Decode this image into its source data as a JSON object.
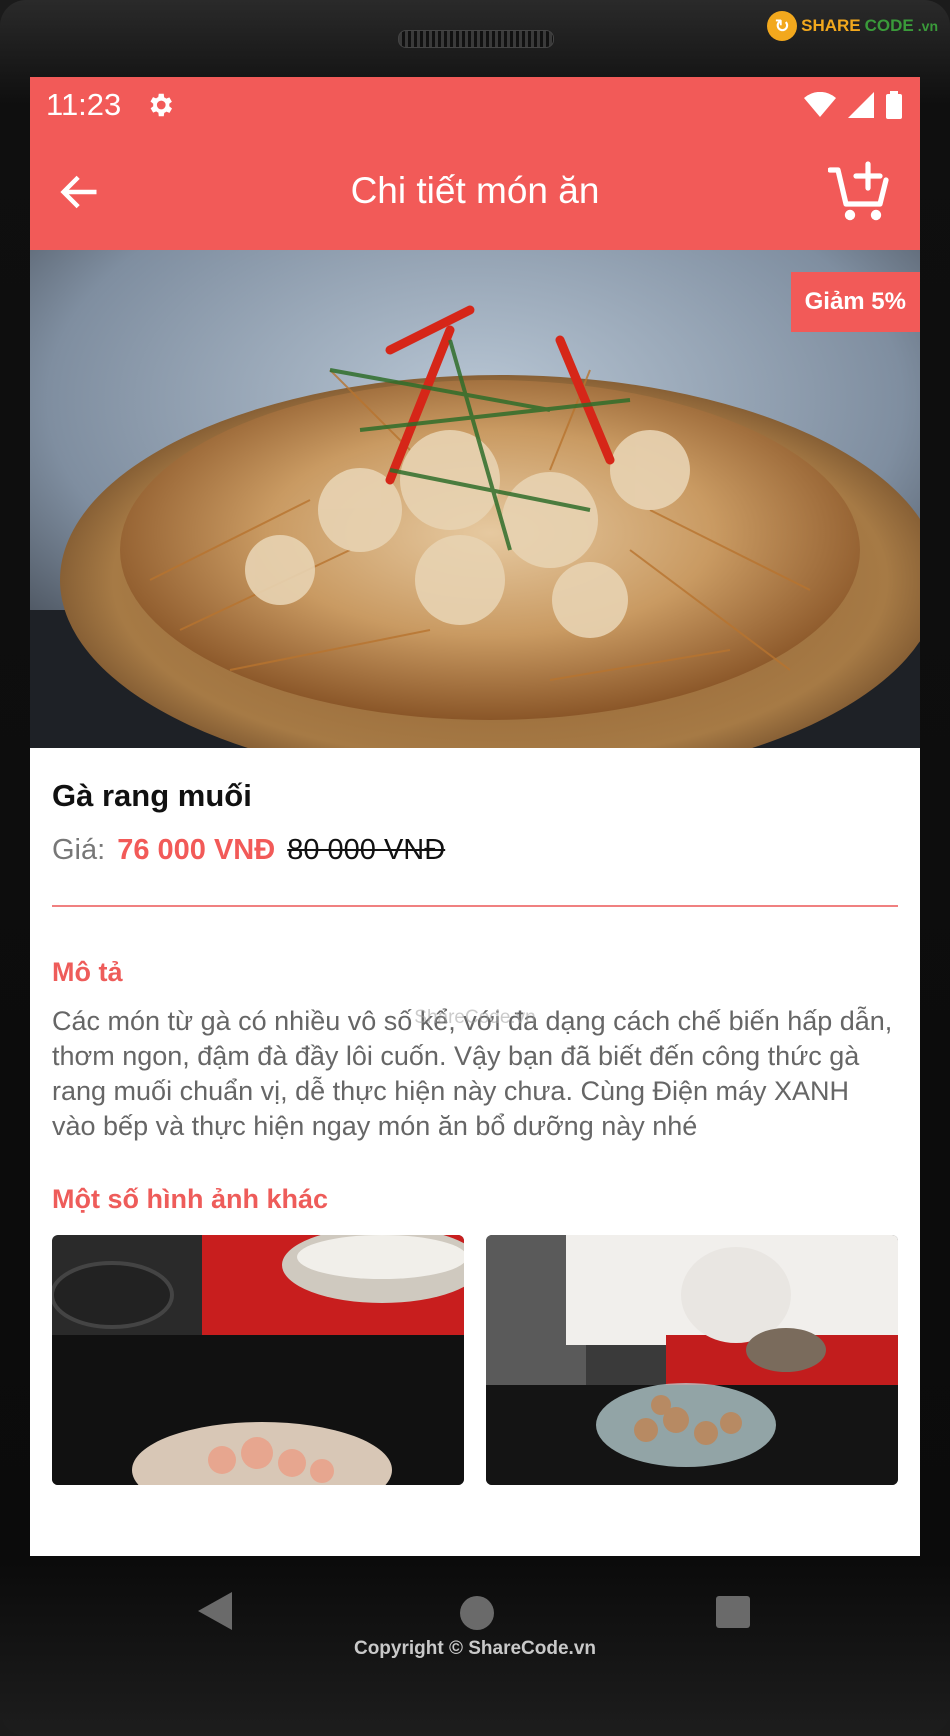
{
  "watermark": {
    "logo_text_a": "SHARE",
    "logo_text_b": "CODE",
    "logo_suffix": ".vn",
    "center_text": "ShareCode.vn"
  },
  "statusbar": {
    "time": "11:23"
  },
  "appbar": {
    "title": "Chi tiết món ăn",
    "back_icon": "arrow-left",
    "cart_icon": "cart-add"
  },
  "hero": {
    "badge": "Giảm 5%"
  },
  "dish": {
    "name": "Gà rang muối",
    "price_label": "Giá:",
    "price_new": "76 000 VNĐ",
    "price_old": "80 000 VNĐ"
  },
  "description": {
    "title": "Mô tả",
    "text": "Các món từ gà có nhiều vô số kể, với đa dạng cách chế biến hấp dẫn, thơm ngon, đậm đà đầy lôi cuốn. Vậy bạn đã biết đến công thức gà rang muối chuẩn vị, dễ thực hiện này chưa. Cùng Điện máy XANH vào bếp và thực hiện ngay món ăn bổ dưỡng này nhé"
  },
  "gallery": {
    "title": "Một số hình ảnh khác"
  },
  "footer": {
    "copyright": "Copyright © ShareCode.vn"
  },
  "colors": {
    "accent": "#f25a58",
    "price": "#f25a58"
  }
}
